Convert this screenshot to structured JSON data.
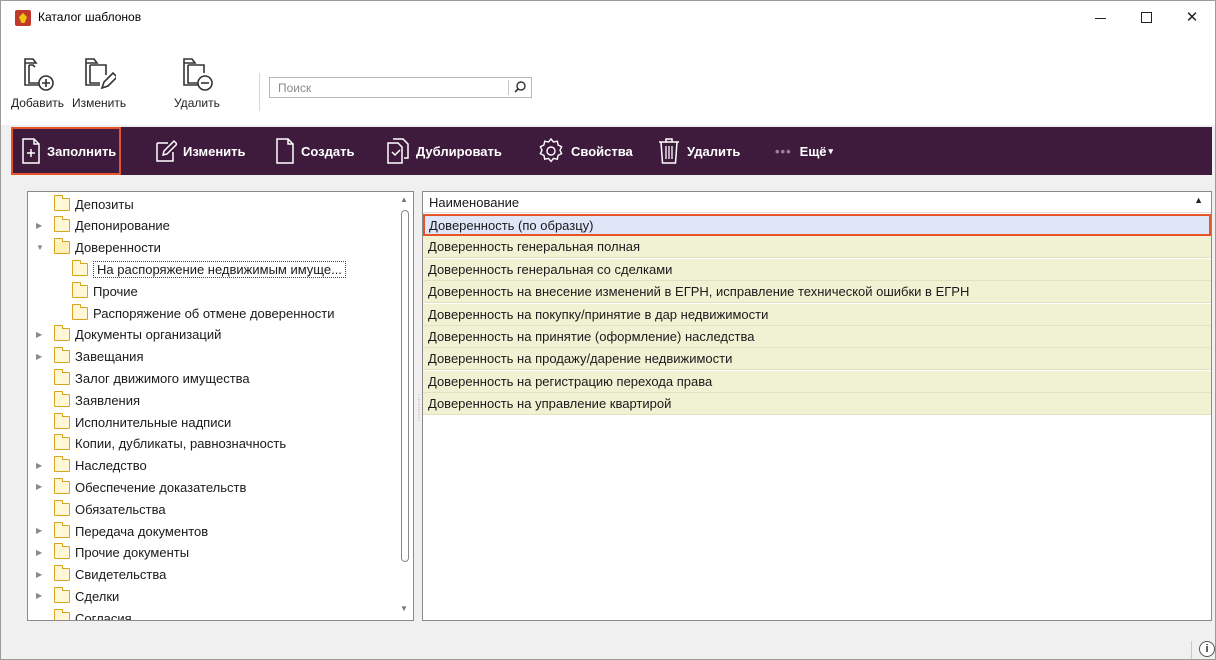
{
  "window": {
    "title": "Каталог шаблонов",
    "min_icon": "minimize-icon",
    "max_icon": "maximize-icon",
    "close_glyph": "✕"
  },
  "ribbon": {
    "add_label": "Добавить",
    "edit_label": "Изменить",
    "delete_label": "Удалить",
    "search_placeholder": "Поиск"
  },
  "toolbar": {
    "fill_label": "Заполнить",
    "edit_label": "Изменить",
    "create_label": "Создать",
    "duplicate_label": "Дублировать",
    "properties_label": "Свойства",
    "delete_label": "Удалить",
    "more_dots": "•••",
    "more_label": "Ещё",
    "more_caret": "▾",
    "background": "#3e1b3d",
    "highlight": "#e8542a"
  },
  "tree": {
    "items": [
      {
        "label": "Депозиты",
        "level": 0,
        "expander": ""
      },
      {
        "label": "Депонирование",
        "level": 0,
        "expander": "▶"
      },
      {
        "label": "Доверенности",
        "level": 0,
        "expander": "▼"
      },
      {
        "label": "На распоряжение недвижимым имуще...",
        "level": 1,
        "expander": ""
      },
      {
        "label": "Прочие",
        "level": 1,
        "expander": ""
      },
      {
        "label": "Распоряжение об отмене доверенности",
        "level": 1,
        "expander": ""
      },
      {
        "label": "Документы организаций",
        "level": 0,
        "expander": "▶"
      },
      {
        "label": "Завещания",
        "level": 0,
        "expander": "▶"
      },
      {
        "label": "Залог движимого имущества",
        "level": 0,
        "expander": ""
      },
      {
        "label": "Заявления",
        "level": 0,
        "expander": ""
      },
      {
        "label": "Исполнительные надписи",
        "level": 0,
        "expander": ""
      },
      {
        "label": "Копии, дубликаты, равнозначность",
        "level": 0,
        "expander": ""
      },
      {
        "label": "Наследство",
        "level": 0,
        "expander": "▶"
      },
      {
        "label": "Обеспечение доказательств",
        "level": 0,
        "expander": "▶"
      },
      {
        "label": "Обязательства",
        "level": 0,
        "expander": ""
      },
      {
        "label": "Передача документов",
        "level": 0,
        "expander": "▶"
      },
      {
        "label": "Прочие документы",
        "level": 0,
        "expander": "▶"
      },
      {
        "label": "Свидетельства",
        "level": 0,
        "expander": "▶"
      },
      {
        "label": "Сделки",
        "level": 0,
        "expander": "▶"
      },
      {
        "label": "Согласия",
        "level": 0,
        "expander": ""
      }
    ],
    "selected_index": 3,
    "scroll_up": "▲",
    "scroll_down": "▼"
  },
  "grid": {
    "header": "Наименование",
    "sort_glyph": "▲",
    "rows": [
      "Доверенность (по образцу)",
      "Доверенность генеральная полная",
      "Доверенность генеральная со сделками",
      "Доверенность на внесение изменений в ЕГРН, исправление технической ошибки в ЕГРН",
      "Доверенность на покупку/принятие в дар недвижимости",
      "Доверенность на принятие (оформление) наследства",
      "Доверенность на продажу/дарение недвижимости",
      "Доверенность на регистрацию перехода права",
      "Доверенность на управление квартирой"
    ],
    "selected_row": 0,
    "row_color": "#f1f1d4"
  },
  "status": {
    "info_glyph": "i"
  }
}
